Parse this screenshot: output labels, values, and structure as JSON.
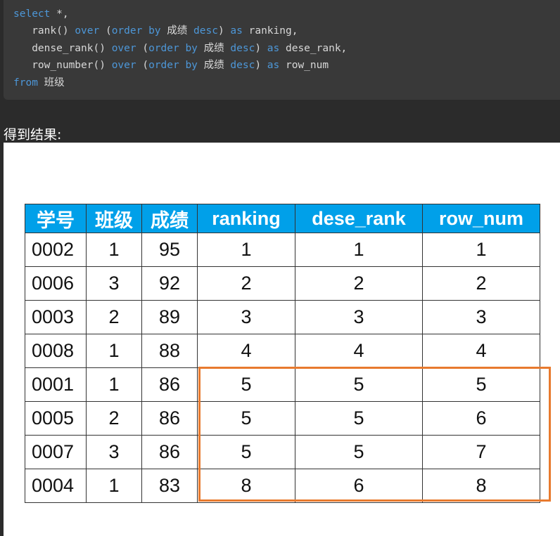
{
  "code": {
    "lines": [
      [
        [
          "kw",
          "select"
        ],
        [
          "t",
          " *,"
        ]
      ],
      [
        [
          "t",
          "   rank() "
        ],
        [
          "kw",
          "over"
        ],
        [
          "t",
          " ("
        ],
        [
          "kw",
          "order by"
        ],
        [
          "t",
          " 成绩 "
        ],
        [
          "kw",
          "desc"
        ],
        [
          "t",
          ") "
        ],
        [
          "kw",
          "as"
        ],
        [
          "t",
          " ranking,"
        ]
      ],
      [
        [
          "t",
          "   dense_rank() "
        ],
        [
          "kw",
          "over"
        ],
        [
          "t",
          " ("
        ],
        [
          "kw",
          "order by"
        ],
        [
          "t",
          " 成绩 "
        ],
        [
          "kw",
          "desc"
        ],
        [
          "t",
          ") "
        ],
        [
          "kw",
          "as"
        ],
        [
          "t",
          " dese_rank,"
        ]
      ],
      [
        [
          "t",
          "   row_number() "
        ],
        [
          "kw",
          "over"
        ],
        [
          "t",
          " ("
        ],
        [
          "kw",
          "order by"
        ],
        [
          "t",
          " 成绩 "
        ],
        [
          "kw",
          "desc"
        ],
        [
          "t",
          ") "
        ],
        [
          "kw",
          "as"
        ],
        [
          "t",
          " row_num"
        ]
      ],
      [
        [
          "kw",
          "from"
        ],
        [
          "t",
          " 班级"
        ]
      ]
    ]
  },
  "caption": "得到结果:",
  "table": {
    "headers": [
      "学号",
      "班级",
      "成绩",
      "ranking",
      "dese_rank",
      "row_num"
    ],
    "rows": [
      [
        "0002",
        "1",
        "95",
        "1",
        "1",
        "1"
      ],
      [
        "0006",
        "3",
        "92",
        "2",
        "2",
        "2"
      ],
      [
        "0003",
        "2",
        "89",
        "3",
        "3",
        "3"
      ],
      [
        "0008",
        "1",
        "88",
        "4",
        "4",
        "4"
      ],
      [
        "0001",
        "1",
        "86",
        "5",
        "5",
        "5"
      ],
      [
        "0005",
        "2",
        "86",
        "5",
        "5",
        "6"
      ],
      [
        "0007",
        "3",
        "86",
        "5",
        "5",
        "7"
      ],
      [
        "0004",
        "1",
        "83",
        "8",
        "6",
        "8"
      ]
    ]
  },
  "colors": {
    "header": "#00a0e9",
    "highlight": "#e87a2e",
    "keyword": "#4d97d8"
  }
}
